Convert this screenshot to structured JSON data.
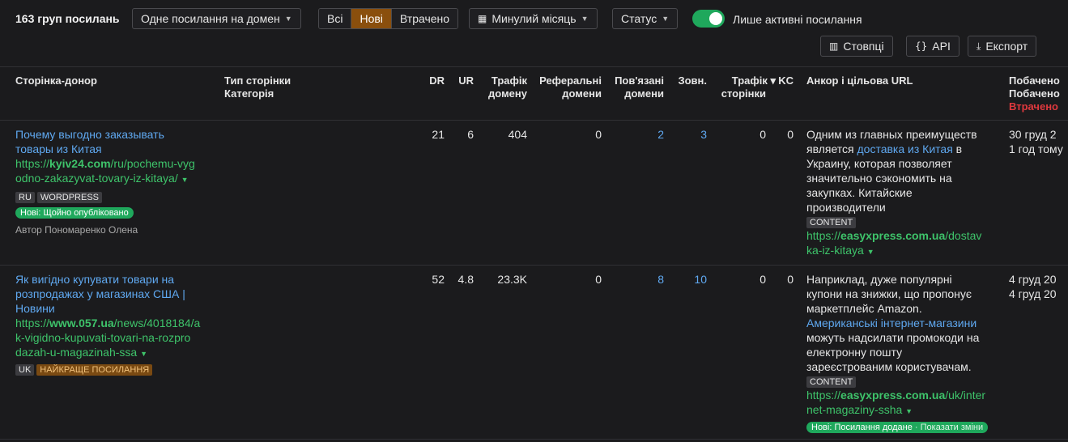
{
  "toolbar": {
    "count_label": "163 груп посилань",
    "mode_dropdown": "Одне посилання на домен",
    "segments": [
      "Всі",
      "Нові",
      "Втрачено"
    ],
    "period_dropdown": "Минулий місяць",
    "status_dropdown": "Статус",
    "active_only_label": "Лише активні посилання",
    "active_only_on": true,
    "columns_button": "Стовпці",
    "api_button": "API",
    "export_button": "Експорт"
  },
  "colors": {
    "accent_active": "#8a4f0d",
    "toggle_green": "#1fa85c",
    "link_blue": "#5fa8f0",
    "url_green": "#3ec36a",
    "lost_red": "#e0393e"
  },
  "headers": {
    "donor": "Сторінка-донор",
    "page_type": "Тип сторінки",
    "category": "Категорія",
    "dr": "DR",
    "ur": "UR",
    "traffic_domain_1": "Трафік",
    "traffic_domain_2": "домену",
    "ref_domains_1": "Реферальні",
    "ref_domains_2": "домени",
    "linked_domains_1": "Пов'язані",
    "linked_domains_2": "домени",
    "external": "Зовн.",
    "traffic_page_1": "Трафік ▾",
    "traffic_page_2": "сторінки",
    "kc": "KC",
    "anchor": "Анкор і цільова URL",
    "seen_1": "Побачено",
    "seen_2": "Побачено",
    "seen_3": "Втрачено"
  },
  "rows": [
    {
      "title_1": "Почему выгодно заказывать",
      "title_2": "товары из Китая",
      "url_prefix": "https://",
      "url_domain": "kyiv24.com",
      "url_rest_1": "/ru/pochemu-vyg",
      "url_rest_2": "odno-zakazyvat-tovary-iz-kitaya/",
      "tags": [
        "RU",
        "WORDPRESS"
      ],
      "status_pill": "Нові: Щойно опубліковано",
      "author": "Автор Пономаренко Олена",
      "dr": "21",
      "ur": "6",
      "traffic_domain": "404",
      "ref_domains": "0",
      "linked_domains": "2",
      "external": "3",
      "traffic_page": "0",
      "kc": "0",
      "anchor_lines": [
        "Одним из главных преимуществ",
        "является ",
        "доставка из Китая",
        " в",
        "Украину, которая позволяет",
        "значительно сэкономить на",
        "закупках. Китайские",
        "производители"
      ],
      "content_tag": "CONTENT",
      "target_prefix": "https://",
      "target_domain": "easyxpress.com.ua",
      "target_rest_1": "/dostav",
      "target_rest_2": "ka-iz-kitaya",
      "seen_1": "30 груд 2",
      "seen_2": "1 год тому"
    },
    {
      "title_1": "Як вигідно купувати товари на",
      "title_2": "розпродажах у магазинах США |",
      "title_3": "Новини",
      "url_prefix": "https://",
      "url_domain": "www.057.ua",
      "url_rest_1": "/news/4018184/a",
      "url_rest_2": "k-vigidno-kupuvati-tovari-na-rozpro",
      "url_rest_3": "dazah-u-magazinah-ssa",
      "tags": [
        "UK"
      ],
      "best_tag": "НАЙКРАЩЕ ПОСИЛАННЯ",
      "dr": "52",
      "ur": "4.8",
      "traffic_domain": "23.3K",
      "ref_domains": "0",
      "linked_domains": "8",
      "external": "10",
      "traffic_page": "0",
      "kc": "0",
      "anchor_lines": [
        "Наприклад, дуже популярні",
        "купони на знижки, що пропонує",
        "маркетплейс Amazon.",
        "Американські інтернет-магазини",
        "можуть надсилати промокоди на",
        "електронну пошту",
        "зареєстрованим користувачам."
      ],
      "content_tag": "CONTENT",
      "target_prefix": "https://",
      "target_domain": "easyxpress.com.ua",
      "target_rest_1": "/uk/inter",
      "target_rest_2": "net-magaziny-ssha",
      "status_pill": "Нові: Посилання додане",
      "status_pill_link": " · Показати зміни",
      "seen_1": "4 груд 20",
      "seen_2": "4 груд 20"
    }
  ]
}
